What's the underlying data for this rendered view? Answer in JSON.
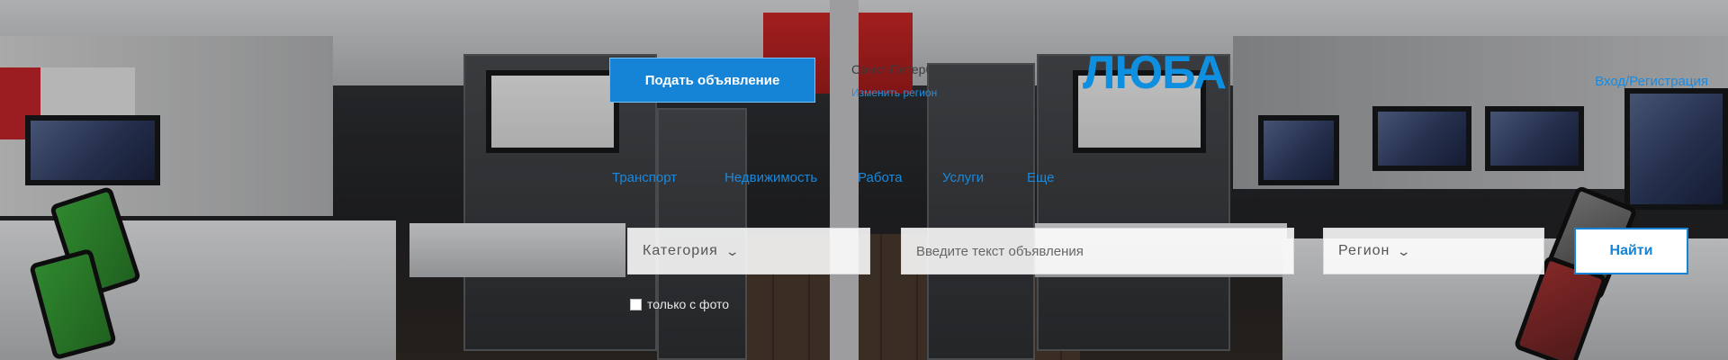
{
  "header": {
    "post_ad_label": "Подать объявление",
    "city": "Санкт-Петербург",
    "change_region_label": "Изменить регион",
    "logo_text": "ЛЮБА",
    "auth_label": "Вход/Регистрация"
  },
  "categories": [
    {
      "label": "Транспорт"
    },
    {
      "label": "Недвижимость"
    },
    {
      "label": "Работа"
    },
    {
      "label": "Услуги"
    },
    {
      "label": "Еще"
    }
  ],
  "search": {
    "category_label": "Категория",
    "query_placeholder": "Введите текст объявления",
    "region_label": "Регион",
    "find_label": "Найти",
    "photo_only_label": "только с фото"
  },
  "colors": {
    "accent": "#1584d6",
    "logo": "#0f8fe0"
  },
  "icons": {
    "dropdown": "chevron-down-icon"
  }
}
